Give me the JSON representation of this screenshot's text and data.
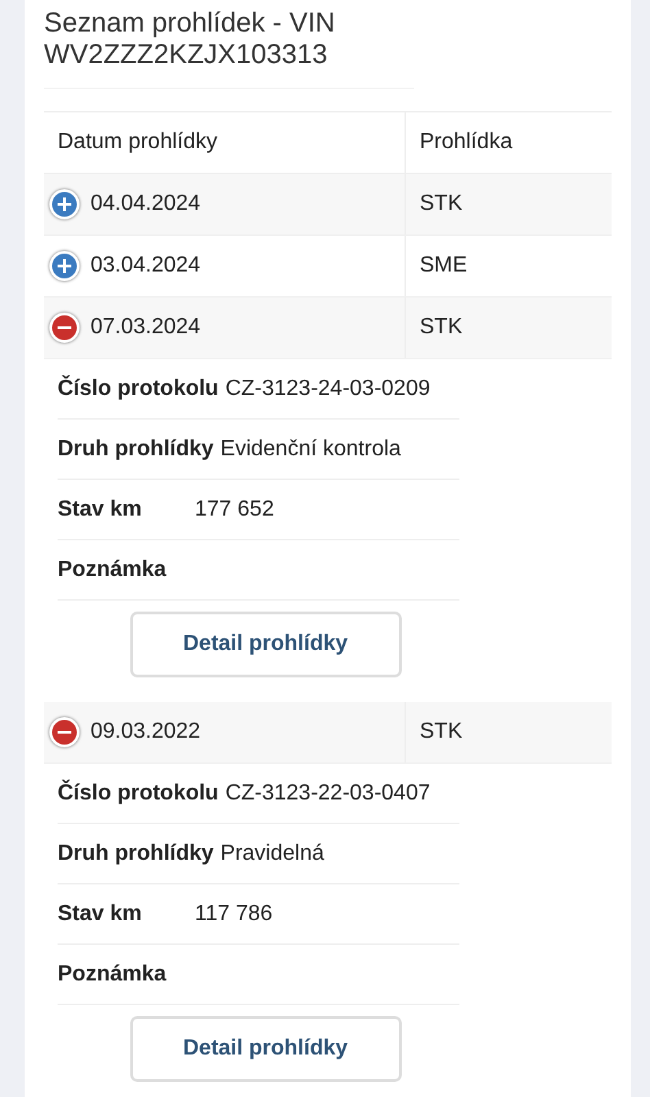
{
  "title": "Seznam prohlídek - VIN WV2ZZZ2KZJX103313",
  "table": {
    "columns": [
      "Datum prohlídky",
      "Prohlídka"
    ],
    "rows": [
      {
        "date": "04.04.2024",
        "type": "STK",
        "expanded": false
      },
      {
        "date": "03.04.2024",
        "type": "SME",
        "expanded": false
      },
      {
        "date": "07.03.2024",
        "type": "STK",
        "expanded": true,
        "details": [
          {
            "label": "Číslo protokolu",
            "value": "CZ-3123-24-03-0209"
          },
          {
            "label": "Druh prohlídky",
            "value": "Evidenční kontrola"
          },
          {
            "label": "Stav km",
            "value": "177 652"
          },
          {
            "label": "Poznámka"
          }
        ],
        "button": "Detail prohlídky"
      },
      {
        "date": "09.03.2022",
        "type": "STK",
        "expanded": true,
        "details": [
          {
            "label": "Číslo protokolu",
            "value": "CZ-3123-22-03-0407"
          },
          {
            "label": "Druh prohlídky",
            "value": "Pravidelná"
          },
          {
            "label": "Stav km",
            "value": "117 786"
          },
          {
            "label": "Poznámka"
          }
        ],
        "button": "Detail prohlídky"
      }
    ]
  }
}
